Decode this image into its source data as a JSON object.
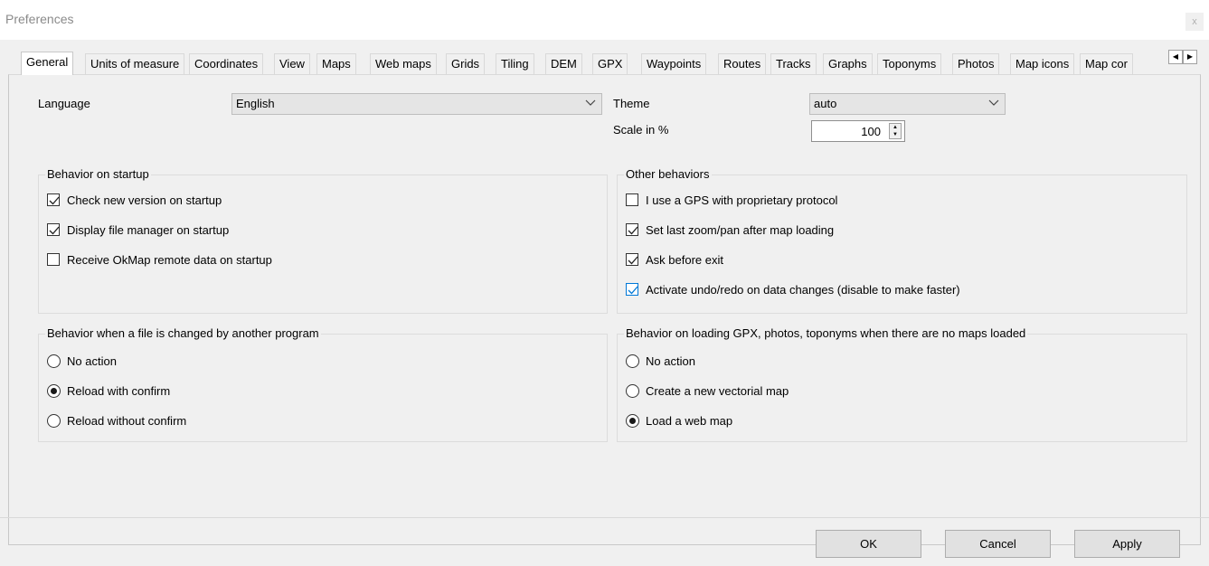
{
  "window": {
    "title": "Preferences",
    "close_glyph": "x"
  },
  "tabs": [
    {
      "label": "General",
      "active": true
    },
    {
      "label": "Units of measure"
    },
    {
      "label": "Coordinates"
    },
    {
      "label": "View"
    },
    {
      "label": "Maps"
    },
    {
      "label": "Web maps"
    },
    {
      "label": "Grids"
    },
    {
      "label": "Tiling"
    },
    {
      "label": "DEM"
    },
    {
      "label": "GPX"
    },
    {
      "label": "Waypoints"
    },
    {
      "label": "Routes"
    },
    {
      "label": "Tracks"
    },
    {
      "label": "Graphs"
    },
    {
      "label": "Toponyms"
    },
    {
      "label": "Photos"
    },
    {
      "label": "Map icons"
    },
    {
      "label": "Map cor"
    }
  ],
  "general": {
    "language_label": "Language",
    "language_value": "English",
    "theme_label": "Theme",
    "theme_value": "auto",
    "scale_label": "Scale in %",
    "scale_value": "100"
  },
  "startup_group": {
    "title": "Behavior on startup",
    "items": [
      {
        "label": "Check new version on startup",
        "checked": true
      },
      {
        "label": "Display file manager on startup",
        "checked": true
      },
      {
        "label": "Receive OkMap remote data on startup",
        "checked": false
      }
    ]
  },
  "other_group": {
    "title": "Other behaviors",
    "items": [
      {
        "label": "I use a GPS with proprietary protocol",
        "checked": false
      },
      {
        "label": "Set last zoom/pan after map loading",
        "checked": true
      },
      {
        "label": "Ask before exit",
        "checked": true
      },
      {
        "label": "Activate undo/redo on data changes (disable to make faster)",
        "checked": true,
        "focused": true
      }
    ]
  },
  "file_changed_group": {
    "title": "Behavior when a file is changed by another program",
    "items": [
      {
        "label": "No action",
        "selected": false
      },
      {
        "label": "Reload with confirm",
        "selected": true
      },
      {
        "label": "Reload without confirm",
        "selected": false
      }
    ]
  },
  "loading_group": {
    "title": "Behavior on loading GPX, photos, toponyms when there are no maps loaded",
    "items": [
      {
        "label": "No action",
        "selected": false
      },
      {
        "label": "Create a new vectorial map",
        "selected": false
      },
      {
        "label": "Load a web map",
        "selected": true
      }
    ]
  },
  "buttons": {
    "ok": "OK",
    "cancel": "Cancel",
    "apply": "Apply"
  },
  "colors": {
    "accent": "#0078d7",
    "dialog_bg": "#f0f0f0"
  },
  "icons": {
    "chevron": "chevron-down-icon",
    "check": "check-icon",
    "scroll_left": "arrow-left-icon",
    "scroll_right": "arrow-right-icon"
  }
}
